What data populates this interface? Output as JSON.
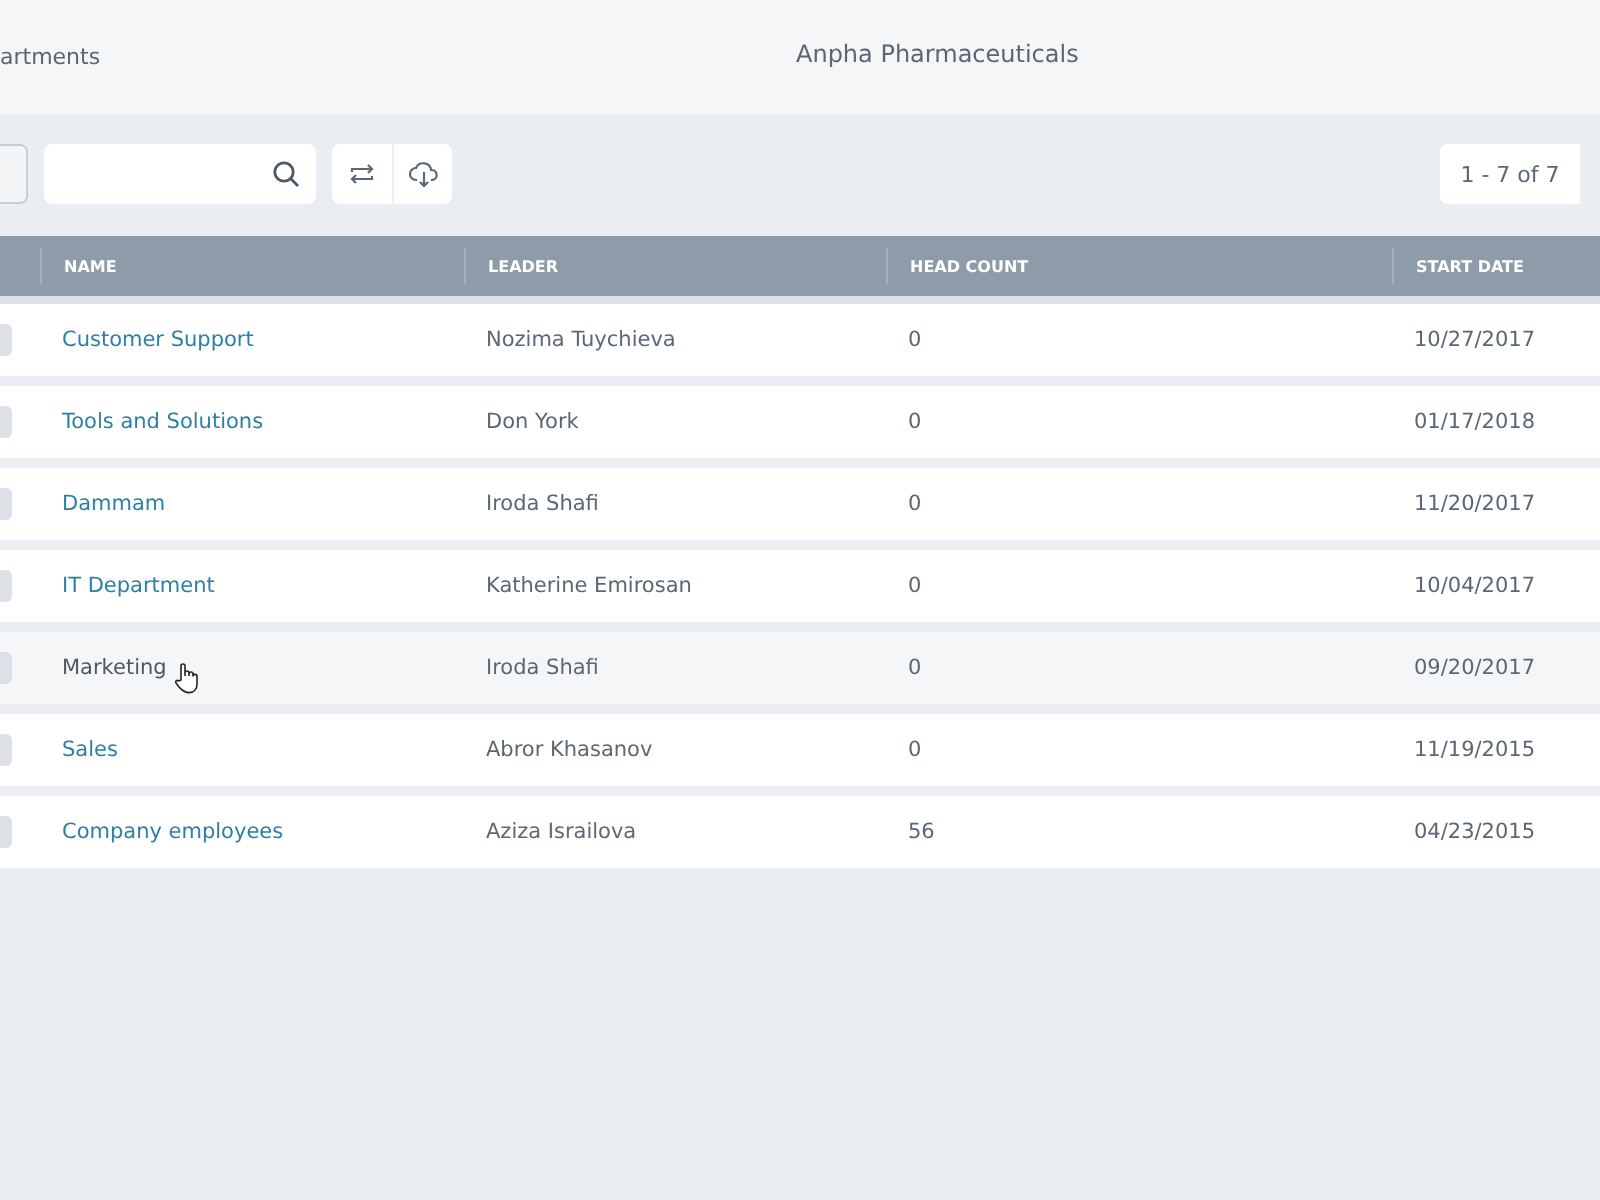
{
  "header": {
    "breadcrumb": "artments",
    "title": "Anpha Pharmaceuticals"
  },
  "toolbar": {
    "pagination": "1 - 7 of 7"
  },
  "table": {
    "columns": [
      "NAME",
      "LEADER",
      "HEAD COUNT",
      "START DATE"
    ],
    "rows": [
      {
        "name": "Customer Support",
        "leader": "Nozima Tuychieva",
        "head_count": "0",
        "start_date": "10/27/2017",
        "hovered": false
      },
      {
        "name": "Tools and Solutions",
        "leader": "Don York",
        "head_count": "0",
        "start_date": "01/17/2018",
        "hovered": false
      },
      {
        "name": "Dammam",
        "leader": "Iroda Shafi",
        "head_count": "0",
        "start_date": "11/20/2017",
        "hovered": false
      },
      {
        "name": "IT Department",
        "leader": "Katherine Emirosan",
        "head_count": "0",
        "start_date": "10/04/2017",
        "hovered": false
      },
      {
        "name": "Marketing",
        "leader": "Iroda Shafi",
        "head_count": "0",
        "start_date": "09/20/2017",
        "hovered": true
      },
      {
        "name": "Sales",
        "leader": "Abror Khasanov",
        "head_count": "0",
        "start_date": "11/19/2015",
        "hovered": false
      },
      {
        "name": "Company employees",
        "leader": "Aziza Israilova",
        "head_count": "56",
        "start_date": "04/23/2015",
        "hovered": false
      }
    ]
  }
}
